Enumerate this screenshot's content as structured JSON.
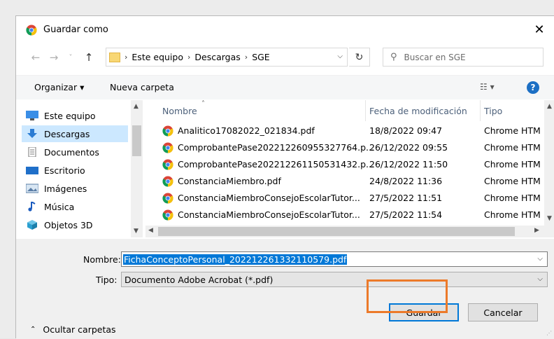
{
  "window": {
    "title": "Guardar como",
    "close_label": "✕"
  },
  "nav": {
    "back": "←",
    "forward": "→",
    "recent": "˅",
    "up": "↑",
    "breadcrumb": [
      "Este equipo",
      "Descargas",
      "SGE"
    ],
    "search_placeholder": "Buscar en SGE"
  },
  "toolbar": {
    "organize": "Organizar ▾",
    "new_folder": "Nueva carpeta",
    "help": "?"
  },
  "sidebar": {
    "items": [
      {
        "label": "Este equipo",
        "icon": "computer-icon"
      },
      {
        "label": "Descargas",
        "icon": "download-icon",
        "selected": true
      },
      {
        "label": "Documentos",
        "icon": "document-icon"
      },
      {
        "label": "Escritorio",
        "icon": "desktop-icon"
      },
      {
        "label": "Imágenes",
        "icon": "image-icon"
      },
      {
        "label": "Música",
        "icon": "music-icon"
      },
      {
        "label": "Objetos 3D",
        "icon": "cube-icon"
      }
    ]
  },
  "columns": {
    "name": "Nombre",
    "modified": "Fecha de modificación",
    "type": "Tipo"
  },
  "files": [
    {
      "name": "Analitico17082022_021834.pdf",
      "date": "18/8/2022 09:47",
      "type": "Chrome HTM"
    },
    {
      "name": "ComprobantePase202212260955327764.p...",
      "date": "26/12/2022 09:55",
      "type": "Chrome HTM"
    },
    {
      "name": "ComprobantePase202212261150531432.p...",
      "date": "26/12/2022 11:50",
      "type": "Chrome HTM"
    },
    {
      "name": "ConstanciaMiembro.pdf",
      "date": "24/8/2022 11:36",
      "type": "Chrome HTM"
    },
    {
      "name": "ConstanciaMiembroConsejoEscolarTutor...",
      "date": "27/5/2022 11:51",
      "type": "Chrome HTM"
    },
    {
      "name": "ConstanciaMiembroConsejoEscolarTutor...",
      "date": "27/5/2022 11:54",
      "type": "Chrome HTM"
    }
  ],
  "form": {
    "name_label": "Nombre:",
    "name_value": "FichaConceptoPersonal_202212261332110579.pdf",
    "type_label": "Tipo:",
    "type_value": "Documento Adobe Acrobat (*.pdf)"
  },
  "footer": {
    "hide_folders": "Ocultar carpetas",
    "save": "Guardar",
    "cancel": "Cancelar"
  },
  "colors": {
    "selection": "#0078d7",
    "highlight": "#ec7a2a",
    "help": "#1c6fc4"
  }
}
